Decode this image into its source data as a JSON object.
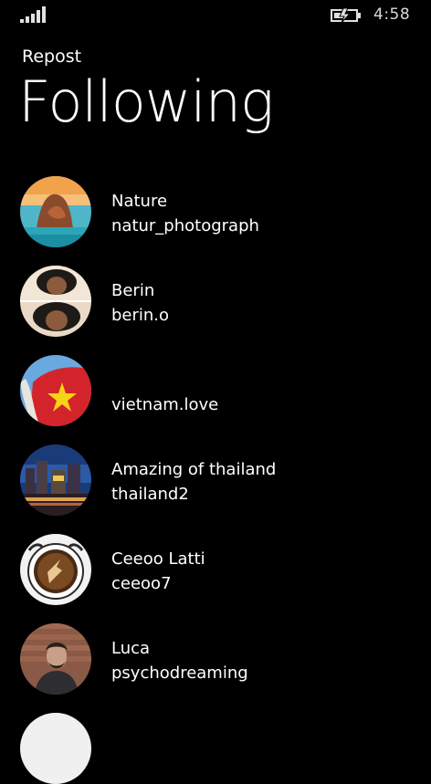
{
  "status_bar": {
    "signal_icon": "signal-strength-icon",
    "battery_icon": "battery-charging-icon",
    "time": "4:58"
  },
  "header": {
    "app_title": "Repost",
    "page_title": "Following"
  },
  "following": [
    {
      "name": "Nature",
      "handle": "natur_photograph",
      "avatar": "nature-avatar"
    },
    {
      "name": "Berin",
      "handle": "berin.o",
      "avatar": "berin-avatar"
    },
    {
      "name": "",
      "handle": "vietnam.love",
      "avatar": "vietnam-flag-avatar"
    },
    {
      "name": "Amazing of thailand",
      "handle": "thailand2",
      "avatar": "thailand-city-avatar"
    },
    {
      "name": "Ceeoo Latti",
      "handle": "ceeoo7",
      "avatar": "coffee-cup-avatar"
    },
    {
      "name": "Luca",
      "handle": "psychodreaming",
      "avatar": "luca-avatar"
    }
  ]
}
